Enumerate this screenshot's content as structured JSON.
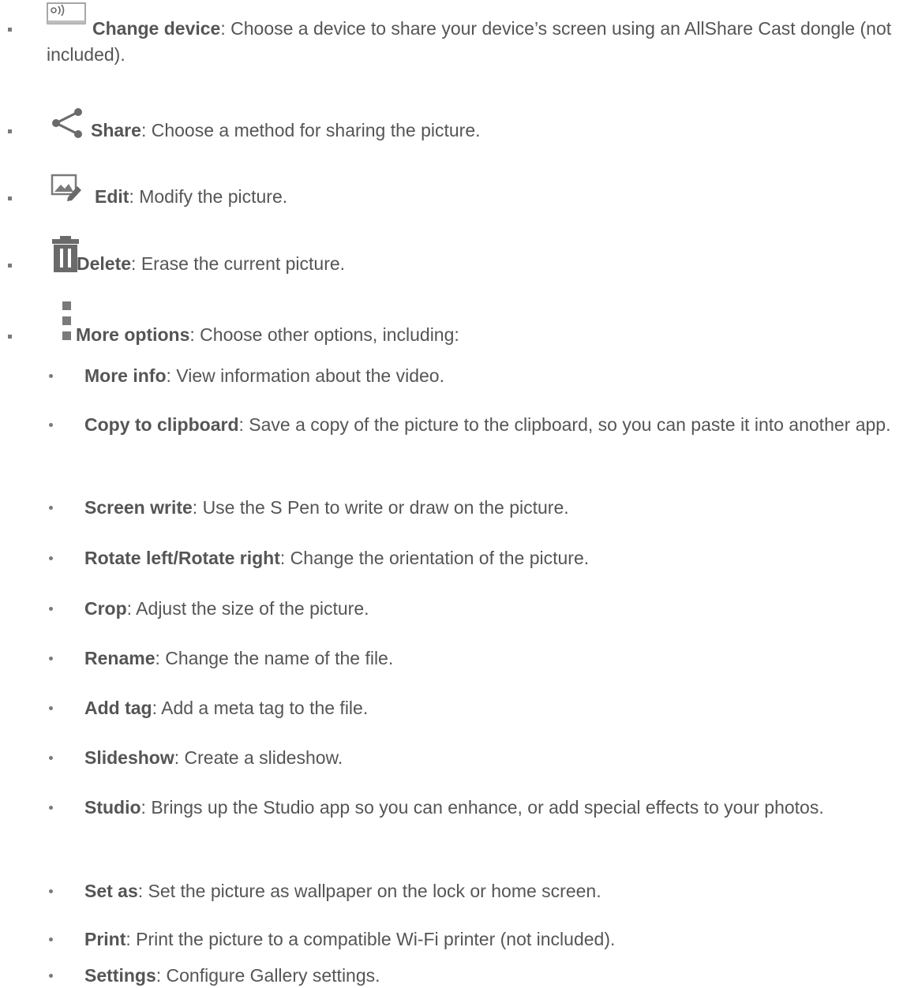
{
  "main_items": [
    {
      "icon": "cast-screen-icon",
      "label": "Change device",
      "text": ": Choose a device to share your device’s screen using an AllShare Cast dongle (not included)."
    },
    {
      "icon": "share-icon",
      "label": "Share",
      "text": ": Choose a method for sharing the picture."
    },
    {
      "icon": "edit-picture-icon",
      "label": "Edit",
      "text": ": Modify the picture."
    },
    {
      "icon": "trash-icon",
      "label": "Delete",
      "text": ": Erase the current picture."
    },
    {
      "icon": "more-options-icon",
      "label": "More options",
      "text": ": Choose other options, including:"
    }
  ],
  "sub_items": [
    {
      "label": "More info",
      "text": ": View information about the video."
    },
    {
      "label": "Copy to clipboard",
      "text": ": Save a copy of the picture to the clipboard, so you can paste it into another app."
    },
    {
      "label": "Screen write",
      "text": ": Use the S Pen to write or draw on the picture."
    },
    {
      "label": "Rotate left/Rotate right",
      "text": ": Change the orientation of the picture."
    },
    {
      "label": "Crop",
      "text": ": Adjust the size of the picture."
    },
    {
      "label": "Rename",
      "text": ": Change the name of the file."
    },
    {
      "label": "Add tag",
      "text": ": Add a meta tag to the file."
    },
    {
      "label": "Slideshow",
      "text": ": Create a slideshow."
    },
    {
      "label": "Studio",
      "text": ": Brings up the Studio app so you can enhance, or add special effects to your photos."
    },
    {
      "label": "Set as",
      "text": ": Set the picture as wallpaper on the lock or home screen."
    },
    {
      "label": "Print",
      "text": ": Print the picture to a compatible Wi-Fi printer (not included)."
    },
    {
      "label": "Settings",
      "text": ": Configure Gallery settings."
    }
  ]
}
